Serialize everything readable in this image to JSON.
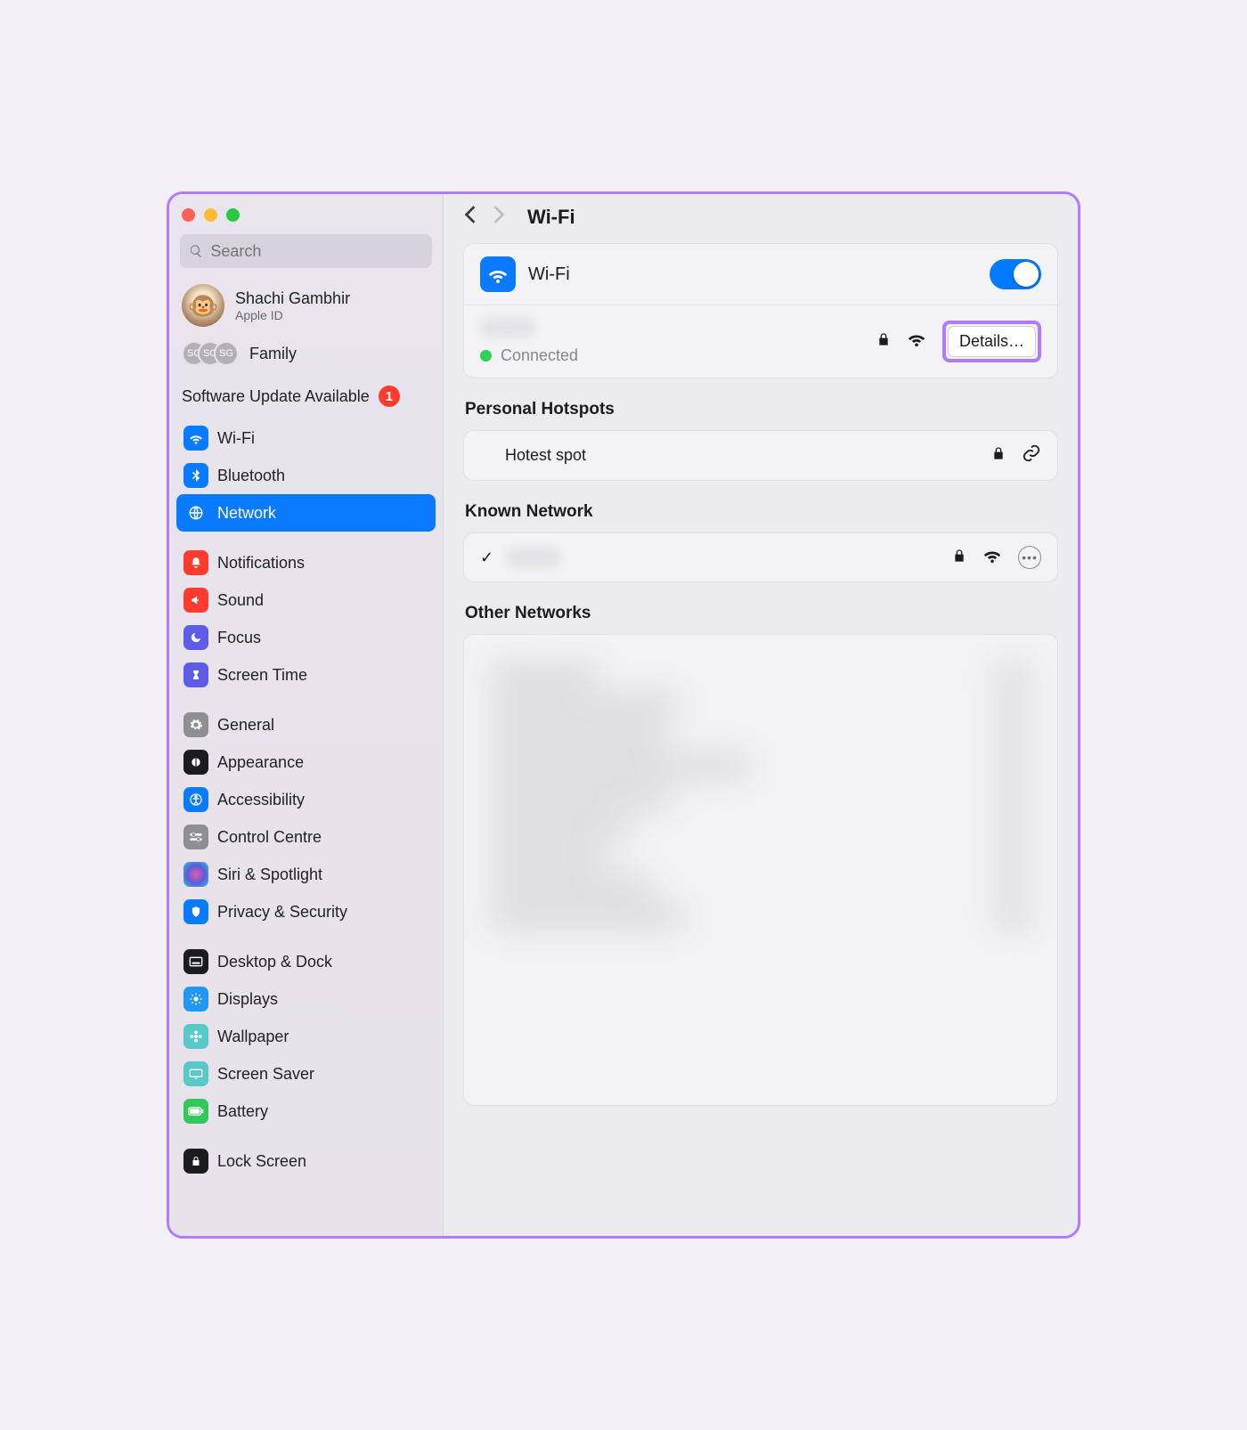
{
  "search": {
    "placeholder": "Search"
  },
  "account": {
    "name": "Shachi Gambhir",
    "sub": "Apple ID"
  },
  "family": {
    "label": "Family",
    "avatars": [
      "SG",
      "SG",
      "SG"
    ]
  },
  "update": {
    "label": "Software Update Available",
    "count": "1"
  },
  "sidebar": {
    "group_connect": [
      {
        "key": "wifi",
        "label": "Wi-Fi"
      },
      {
        "key": "bluetooth",
        "label": "Bluetooth"
      },
      {
        "key": "network",
        "label": "Network",
        "selected": true
      }
    ],
    "group_focus": [
      {
        "key": "notifications",
        "label": "Notifications"
      },
      {
        "key": "sound",
        "label": "Sound"
      },
      {
        "key": "focus",
        "label": "Focus"
      },
      {
        "key": "screentime",
        "label": "Screen Time"
      }
    ],
    "group_general": [
      {
        "key": "general",
        "label": "General"
      },
      {
        "key": "appearance",
        "label": "Appearance"
      },
      {
        "key": "accessibility",
        "label": "Accessibility"
      },
      {
        "key": "controlcentre",
        "label": "Control Centre"
      },
      {
        "key": "siri",
        "label": "Siri & Spotlight"
      },
      {
        "key": "privacy",
        "label": "Privacy & Security"
      }
    ],
    "group_display": [
      {
        "key": "desktopdock",
        "label": "Desktop & Dock"
      },
      {
        "key": "displays",
        "label": "Displays"
      },
      {
        "key": "wallpaper",
        "label": "Wallpaper"
      },
      {
        "key": "screensaver",
        "label": "Screen Saver"
      },
      {
        "key": "battery",
        "label": "Battery"
      }
    ],
    "group_bottom": [
      {
        "key": "lockscreen",
        "label": "Lock Screen"
      }
    ]
  },
  "header": {
    "title": "Wi-Fi"
  },
  "wifi_panel": {
    "title": "Wi-Fi",
    "status": "Connected",
    "details_button": "Details…",
    "enabled": true
  },
  "personal_hotspots": {
    "title": "Personal Hotspots",
    "items": [
      {
        "name": "Hotest spot"
      }
    ]
  },
  "known_network": {
    "title": "Known Network"
  },
  "other_networks": {
    "title": "Other Networks"
  }
}
